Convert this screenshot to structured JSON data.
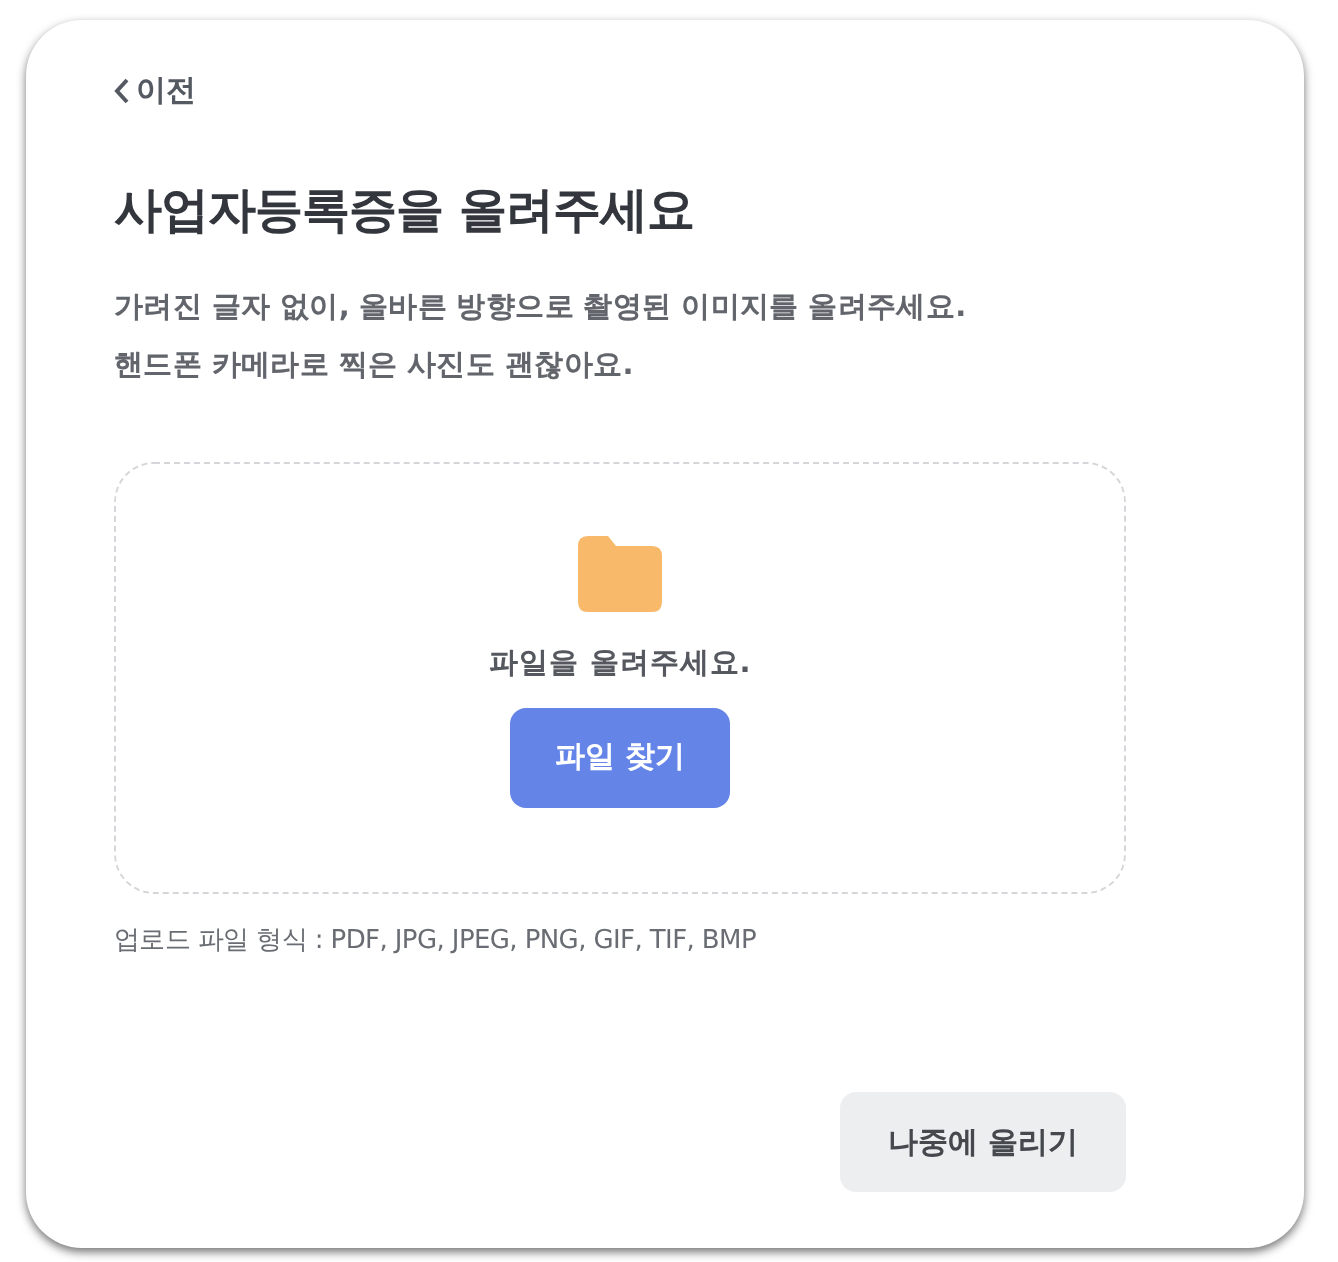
{
  "back_link": {
    "label": "이전"
  },
  "title": "사업자등록증을 올려주세요",
  "description": [
    "가려진 글자 없이, 올바른 방향으로 촬영된 이미지를 올려주세요.",
    "핸드폰 카메라로 찍은 사진도 괜찮아요."
  ],
  "dropzone": {
    "message": "파일을 올려주세요.",
    "button": "파일 찾기"
  },
  "formats_note": "업로드 파일 형식 : PDF, JPG, JPEG, PNG, GIF, TIF, BMP",
  "footer_button": "나중에 올리기"
}
